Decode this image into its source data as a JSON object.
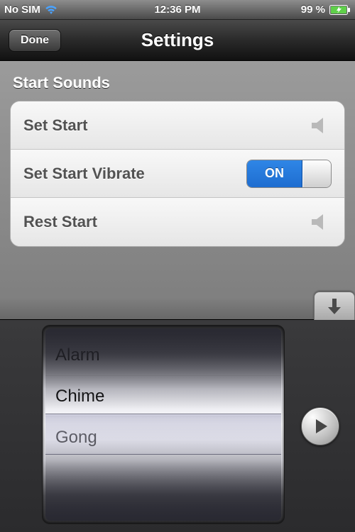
{
  "status": {
    "carrier": "No SIM",
    "time": "12:36 PM",
    "battery_pct": "99 %"
  },
  "nav": {
    "title": "Settings",
    "done_label": "Done"
  },
  "section": {
    "header": "Start Sounds",
    "rows": [
      {
        "label": "Set Start"
      },
      {
        "label": "Set Start Vibrate",
        "toggle_on_text": "ON"
      },
      {
        "label": "Rest Start"
      }
    ]
  },
  "picker": {
    "options": [
      "Alarm",
      "Chime",
      "Gong"
    ],
    "selected_index": 2
  }
}
